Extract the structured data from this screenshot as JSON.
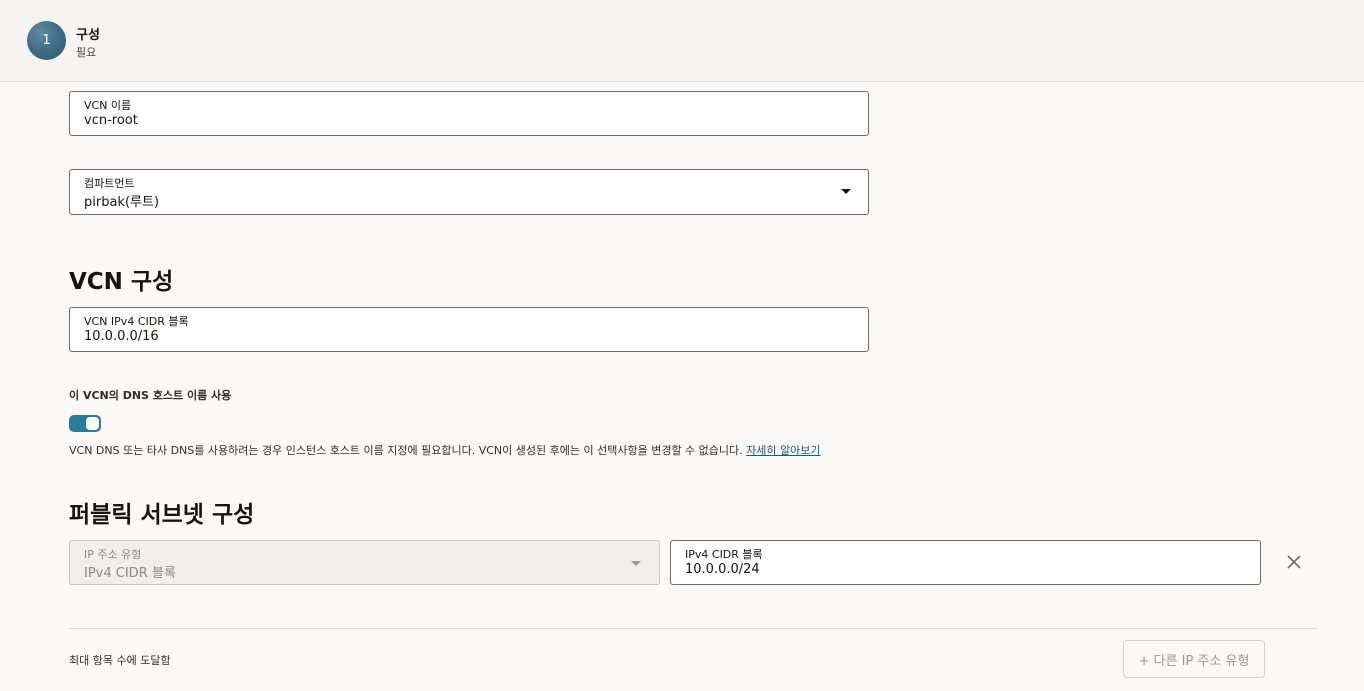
{
  "step": {
    "number": "1",
    "title": "구성",
    "subtitle": "필요"
  },
  "vcn_name": {
    "label": "VCN 이름",
    "value": "vcn-root"
  },
  "compartment": {
    "label": "컴파트먼트",
    "value": "pirbak(루트)"
  },
  "vcn_config": {
    "title": "VCN 구성",
    "cidr_label": "VCN IPv4 CIDR 블록",
    "cidr_value": "10.0.0.0/16",
    "dns_toggle_label": "이 VCN의 DNS 호스트 이름 사용",
    "dns_toggle_on": true,
    "help_text": "VCN DNS 또는 타사 DNS를 사용하려는 경우 인스턴스 호스트 이름 지정에 필요합니다. VCN이 생성된 후에는 이 선택사항을 변경할 수 없습니다.",
    "help_link": "자세히 알아보기"
  },
  "public_subnet": {
    "title": "퍼블릭 서브넷 구성",
    "ip_type_label": "IP 주소 유형",
    "ip_type_value": "IPv4 CIDR 블록",
    "cidr_label": "IPv4 CIDR 블록",
    "cidr_value": "10.0.0.0/24",
    "max_note": "최대 항목 수에 도달함",
    "add_button": "+ 다른 IP 주소 유형"
  },
  "icons": {
    "close": "close-icon",
    "dropdown": "chevron-down-icon"
  },
  "colors": {
    "accent": "#2b7b99",
    "link": "#145c8a"
  }
}
